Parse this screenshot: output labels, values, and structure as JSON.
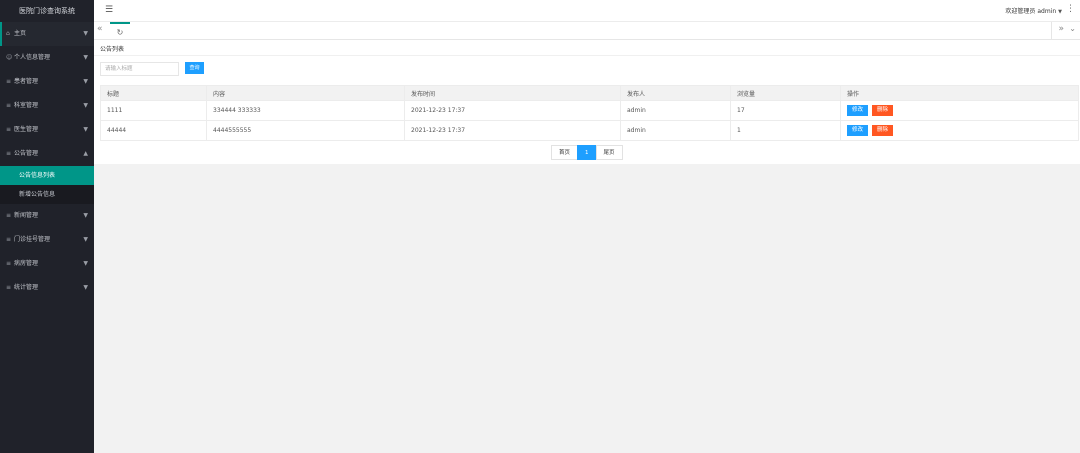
{
  "app": {
    "title": "医院门诊查询系统"
  },
  "header": {
    "welcome": "欢迎管理员",
    "username": "admin"
  },
  "sidebar": {
    "items": [
      {
        "label": "主页",
        "icon": "home-icon"
      },
      {
        "label": "个人信息管理",
        "icon": "user-icon"
      },
      {
        "label": "患者管理",
        "icon": "list-icon"
      },
      {
        "label": "科室管理",
        "icon": "list-icon"
      },
      {
        "label": "医生管理",
        "icon": "list-icon"
      },
      {
        "label": "公告管理",
        "icon": "list-icon"
      },
      {
        "label": "新闻管理",
        "icon": "list-icon"
      },
      {
        "label": "门诊挂号管理",
        "icon": "list-icon"
      },
      {
        "label": "病房管理",
        "icon": "list-icon"
      },
      {
        "label": "统计管理",
        "icon": "list-icon"
      }
    ],
    "submenu": [
      {
        "label": "公告信息列表"
      },
      {
        "label": "新增公告信息"
      }
    ]
  },
  "main": {
    "page_title": "公告列表",
    "search": {
      "placeholder": "请输入标题",
      "button": "查询"
    },
    "table": {
      "columns": [
        "标题",
        "内容",
        "发布时间",
        "发布人",
        "浏览量",
        "操作"
      ],
      "rows": [
        {
          "title": "1111",
          "content": "334444 333333",
          "time": "2021-12-23 17:37",
          "author": "admin",
          "views": "17"
        },
        {
          "title": "44444",
          "content": "4444555555",
          "time": "2021-12-23 17:37",
          "author": "admin",
          "views": "1"
        }
      ],
      "edit_label": "修改",
      "delete_label": "删除"
    },
    "pager": {
      "first": "首页",
      "current": "1",
      "last": "尾页"
    }
  },
  "colors": {
    "sidebar_bg": "#20222a",
    "accent": "#009688",
    "primary": "#1e9fff",
    "danger": "#ff5722"
  }
}
